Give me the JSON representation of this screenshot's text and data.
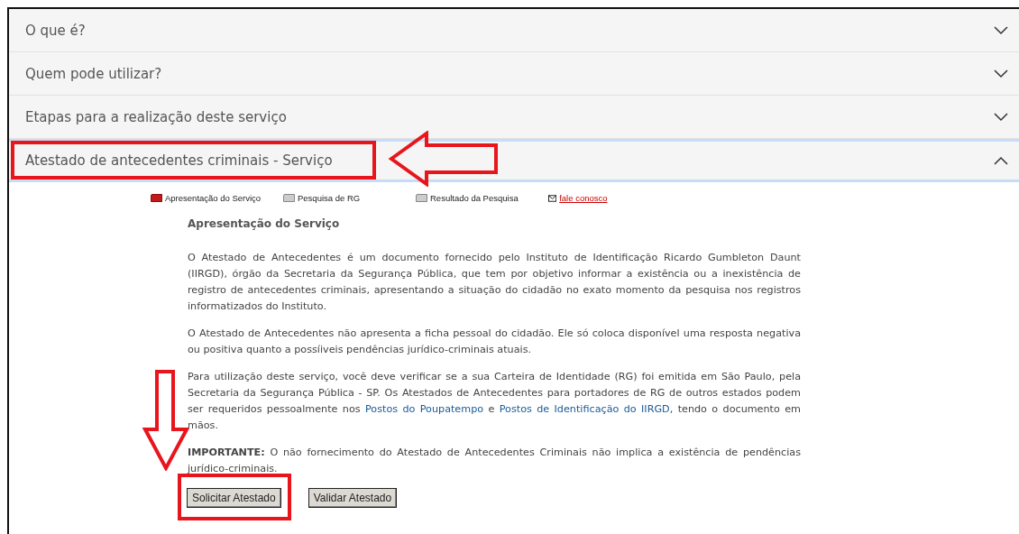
{
  "accordion": [
    {
      "title": "O que é?",
      "expanded": false
    },
    {
      "title": "Quem pode utilizar?",
      "expanded": false
    },
    {
      "title": "Etapas para a realização deste serviço",
      "expanded": false
    },
    {
      "title": "Atestado de antecedentes criminais - Serviço",
      "expanded": true
    }
  ],
  "steps": [
    {
      "label": "Apresentação do Serviço",
      "kind": "step",
      "selected": true
    },
    {
      "label": "Pesquisa de RG",
      "kind": "step",
      "selected": false
    },
    {
      "label": "Resultado da Pesquisa",
      "kind": "step",
      "selected": false
    },
    {
      "label": "fale conosco",
      "kind": "link"
    }
  ],
  "heading": "Apresentação do Serviço",
  "paragraphs": [
    "O Atestado de Antecedentes é um documento fornecido pelo Instituto de Identificação Ricardo Gumbleton Daunt (IIRGD), órgão da Secretaria da Segurança Pública, que tem por objetivo informar a existência ou a inexistência de registro de antecedentes criminais, apresentando a situação do cidadão no exato momento da pesquisa nos registros informatizados do Instituto.",
    "O Atestado de Antecedentes não apresenta a ficha pessoal do cidadão. Ele só coloca disponível uma resposta negativa ou positiva quanto a possíiveis pendências jurídico-criminais atuais."
  ],
  "paragraph_links": {
    "before": "Para utilização deste serviço, você deve verificar se a sua Carteira de Identidade (RG) foi emitida em São Paulo, pela Secretaria da Segurança Pública - SP. Os Atestados de Antecedentes para portadores de RG de outros estados podem ser requeridos pessoalmente nos",
    "link_1": "Postos do Poupatempo",
    "middle": "e",
    "link_2": "Postos de Identificação do IIRGD",
    "after": ", tendo o documento em mãos."
  },
  "important": "**IMPORTANTE:** O não fornecimento do Atestado de Antecedentes Criminais não implica a existência de pendências jurídico-criminais.",
  "buttons": [
    "Solicitar Atestado",
    "Validar Atestado"
  ]
}
